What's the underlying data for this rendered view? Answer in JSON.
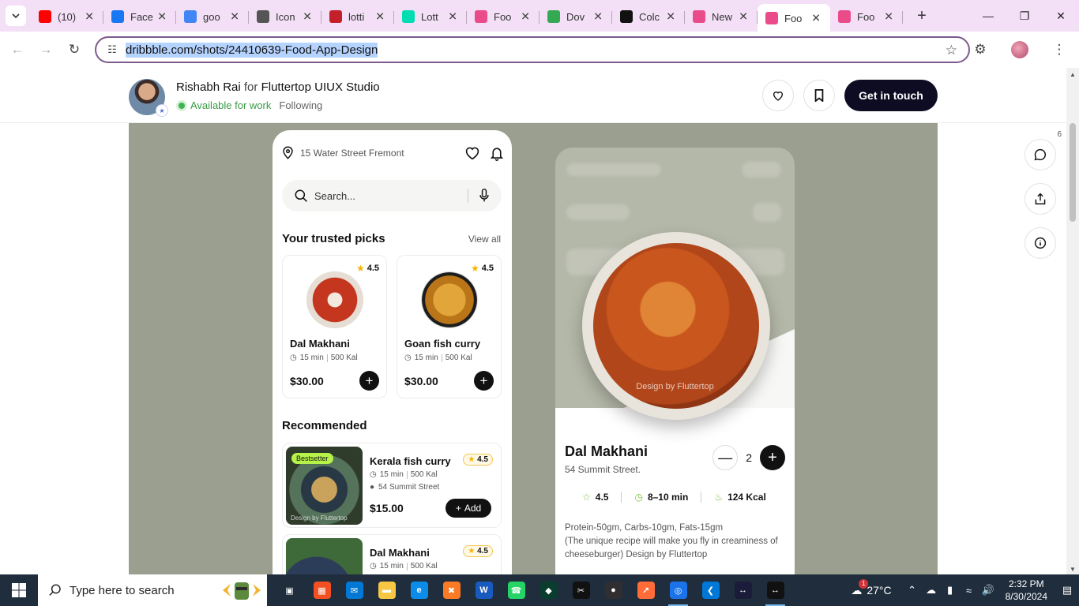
{
  "browser": {
    "tabs": [
      {
        "title": "(10)",
        "icon": "youtube-icon",
        "color": "#ff0000"
      },
      {
        "title": "Face",
        "icon": "facebook-icon",
        "color": "#1877f2"
      },
      {
        "title": "goo",
        "icon": "google-icon",
        "color": "#4285f4"
      },
      {
        "title": "Icon",
        "icon": "icon-site-icon",
        "color": "#555555"
      },
      {
        "title": "lotti",
        "icon": "lottie-red-icon",
        "color": "#c3202b"
      },
      {
        "title": "Lott",
        "icon": "lottie-icon",
        "color": "#00ddb3"
      },
      {
        "title": "Foo",
        "icon": "dribbble-icon",
        "color": "#ea4c89"
      },
      {
        "title": "Dov",
        "icon": "google-photos-icon",
        "color": "#34a853"
      },
      {
        "title": "Colc",
        "icon": "cup-icon",
        "color": "#111111"
      },
      {
        "title": "New",
        "icon": "dribbble-icon",
        "color": "#ea4c89"
      },
      {
        "title": "Foo",
        "icon": "dribbble-icon",
        "color": "#ea4c89"
      },
      {
        "title": "Foo",
        "icon": "dribbble-icon",
        "color": "#ea4c89"
      }
    ],
    "url": "dribbble.com/shots/24410639-Food-App-Design"
  },
  "shot": {
    "designer": "Rishabh Rai",
    "for_word": "for",
    "team": "Fluttertop UIUX Studio",
    "availability": "Available for work",
    "following": "Following",
    "cta": "Get in touch",
    "comment_count": "6"
  },
  "app1": {
    "location": "15 Water Street Fremont",
    "search_placeholder": "Search...",
    "trusted_title": "Your trusted picks",
    "view_all": "View all",
    "picks": [
      {
        "name": "Dal Makhani",
        "rating": "4.5",
        "time": "15 min",
        "cal": "500 Kal",
        "price": "$30.00"
      },
      {
        "name": "Goan fish curry",
        "rating": "4.5",
        "time": "15 min",
        "cal": "500 Kal",
        "price": "$30.00"
      }
    ],
    "recommended_title": "Recommended",
    "recommended": [
      {
        "badge": "Bestsetter",
        "watermark": "Design by Fluttertop",
        "name": "Kerala fish curry",
        "rating": "4.5",
        "time": "15 min",
        "cal": "500 Kal",
        "address": "54 Summit Street",
        "price": "$15.00",
        "add": "Add"
      },
      {
        "name": "Dal Makhani",
        "rating": "4.5",
        "time": "15 min",
        "cal": "500 Kal"
      }
    ]
  },
  "app2": {
    "watermark": "Design by Fluttertop",
    "name": "Dal Makhani",
    "address": "54 Summit Street.",
    "quantity": "2",
    "rating": "4.5",
    "time": "8–10 min",
    "kcal": "124 Kcal",
    "description": "Protein-50gm, Carbs-10gm, Fats-15gm\n(The unique recipe will make you fly in creaminess of cheeseburger) Design by Fluttertop"
  },
  "taskbar": {
    "search_placeholder": "Type here to search",
    "temperature": "27°C",
    "weather_badge": "1",
    "time": "2:32 PM",
    "date": "8/30/2024"
  }
}
